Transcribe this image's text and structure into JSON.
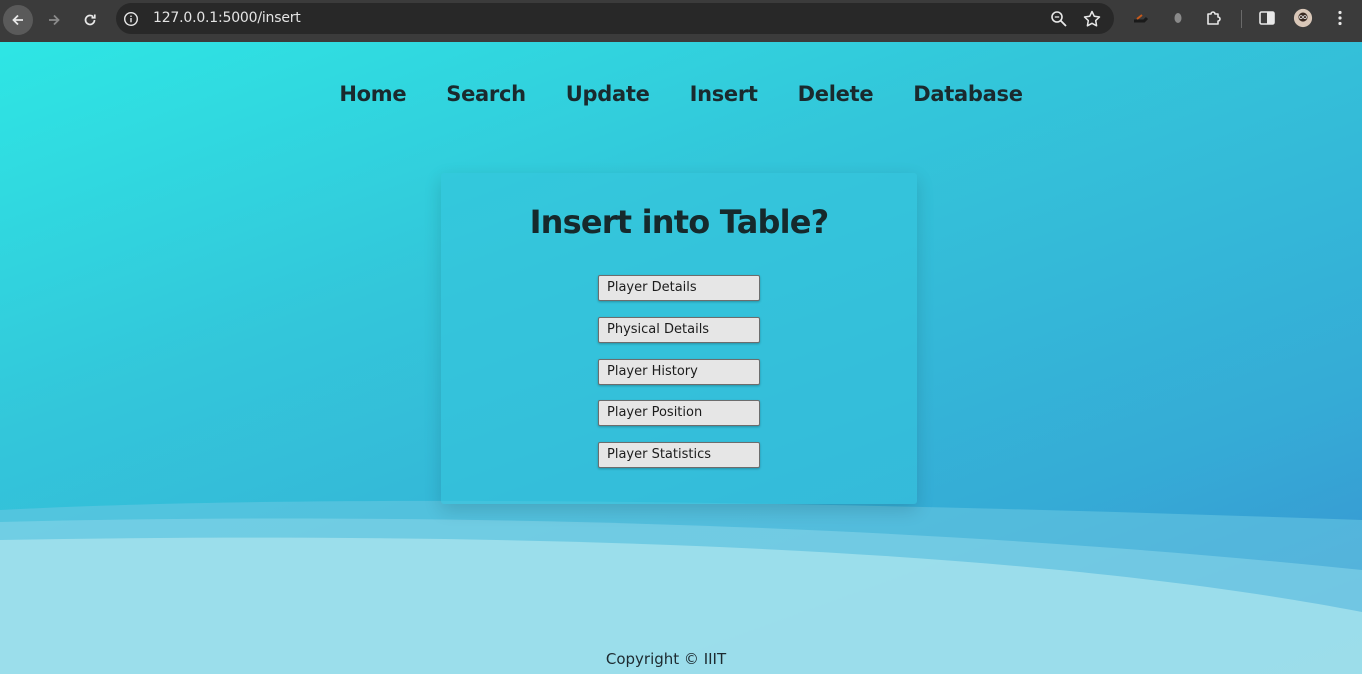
{
  "browser": {
    "url": "127.0.0.1:5000/insert"
  },
  "nav": {
    "items": [
      {
        "label": "Home"
      },
      {
        "label": "Search"
      },
      {
        "label": "Update"
      },
      {
        "label": "Insert"
      },
      {
        "label": "Delete"
      },
      {
        "label": "Database"
      }
    ]
  },
  "card": {
    "title": "Insert into Table?",
    "buttons": [
      {
        "label": "Player Details"
      },
      {
        "label": "Physical Details"
      },
      {
        "label": "Player History"
      },
      {
        "label": "Player Position"
      },
      {
        "label": "Player Statistics"
      }
    ]
  },
  "footer": {
    "copyright": "Copyright © IIIT"
  },
  "colors": {
    "chrome_bg": "#3b3b3b",
    "page_gradient_start": "#2ee6e4",
    "page_gradient_end": "#3a8fd1",
    "button_bg": "#e6e6e6",
    "heading_text": "#16292c"
  }
}
